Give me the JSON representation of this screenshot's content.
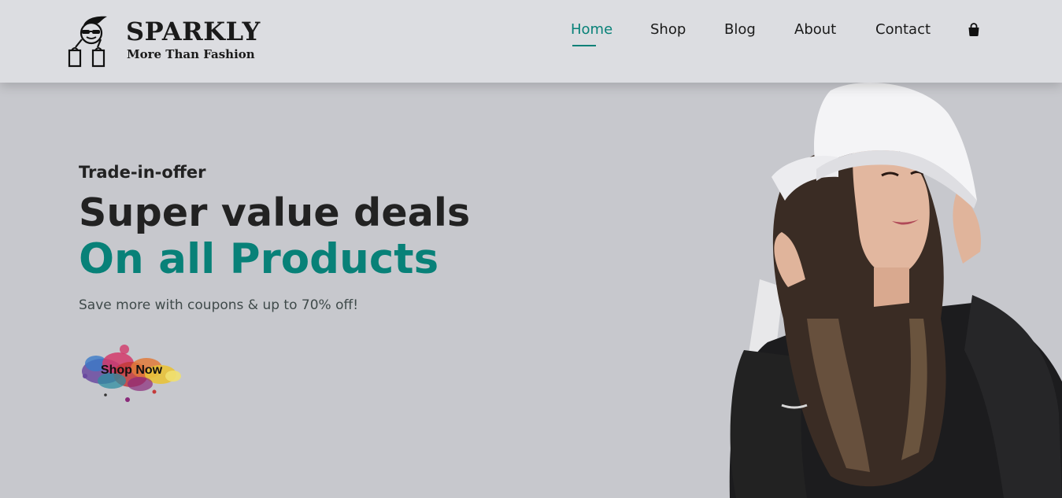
{
  "brand": {
    "name": "SPARKLY",
    "tagline": "More Than Fashion"
  },
  "nav": {
    "items": [
      {
        "label": "Home",
        "active": true
      },
      {
        "label": "Shop",
        "active": false
      },
      {
        "label": "Blog",
        "active": false
      },
      {
        "label": "About",
        "active": false
      },
      {
        "label": "Contact",
        "active": false
      }
    ],
    "cart_icon": "shopping-bag-icon"
  },
  "hero": {
    "kicker": "Trade-in-offer",
    "title": "Super value deals",
    "subtitle": "On all Products",
    "note": "Save more with coupons & up to 70% off!",
    "button_label": "Shop Now"
  },
  "colors": {
    "accent": "#088178",
    "header_bg": "#dcdde1",
    "page_bg": "#c7c8cd",
    "text": "#222222"
  }
}
